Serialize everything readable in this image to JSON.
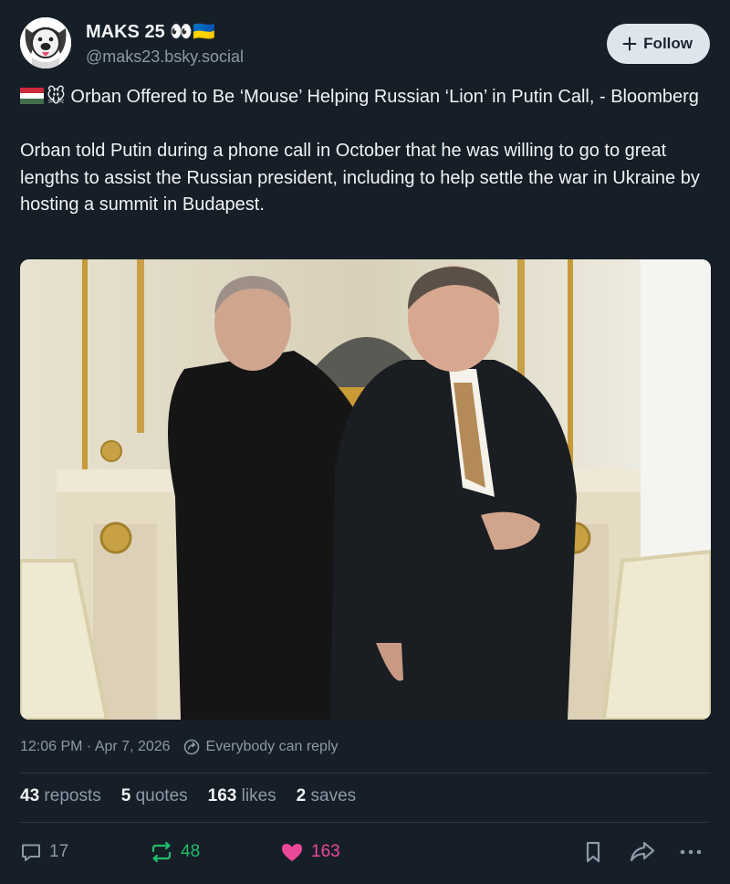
{
  "author": {
    "display_name": "MAKS 25 👀🇺🇦",
    "handle": "@maks23.bsky.social",
    "avatar_icon": "cartoon-dog-avatar"
  },
  "follow_button": {
    "label": "Follow",
    "icon": "plus-icon"
  },
  "post": {
    "title_emoji": "🐭",
    "title_text": " Orban Offered to Be ‘Mouse’ Helping Russian ‘Lion’ in Putin Call, - Bloomberg",
    "body": "Orban told Putin during a phone call in October that he was willing to go to great lengths to assist the Russian president, including to help settle the war in Ukraine by hosting a summit in Budapest."
  },
  "image": {
    "subject": "putin-and-orban-photo"
  },
  "meta": {
    "timestamp": "12:06 PM · Apr 7, 2026",
    "reply_setting": "Everybody can reply"
  },
  "stats": {
    "reposts_count": "43",
    "reposts_label": "reposts",
    "quotes_count": "5",
    "quotes_label": "quotes",
    "likes_count": "163",
    "likes_label": "likes",
    "saves_count": "2",
    "saves_label": "saves"
  },
  "actions": {
    "reply_count": "17",
    "repost_count": "48",
    "like_count": "163"
  },
  "colors": {
    "background": "#161e27",
    "repost_green": "#20bc6a",
    "like_pink": "#ec4899",
    "muted": "#8d99a8"
  }
}
